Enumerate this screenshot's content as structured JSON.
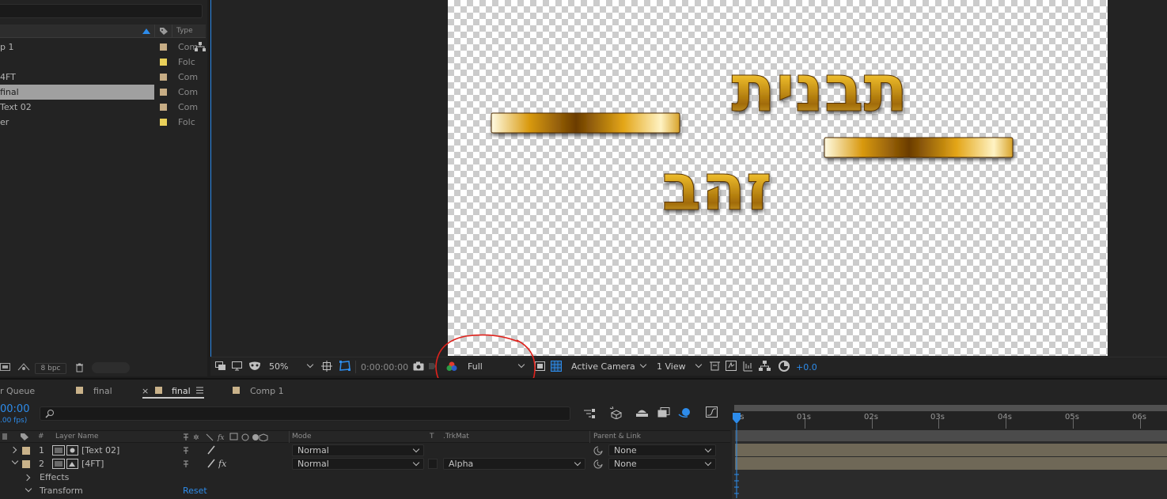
{
  "project": {
    "header": {
      "type_label": "Type"
    },
    "items": [
      {
        "name": "p 1",
        "type": "Com",
        "color": "#c7ad85"
      },
      {
        "name": "",
        "type": "Folc",
        "color": "#e9d05a"
      },
      {
        "name": "4FT",
        "type": "Com",
        "color": "#c7ad85"
      },
      {
        "name": "final",
        "type": "Com",
        "color": "#c7ad85",
        "selected": true
      },
      {
        "name": "Text 02",
        "type": "Com",
        "color": "#c7ad85"
      },
      {
        "name": "er",
        "type": "Folc",
        "color": "#e9d05a"
      }
    ],
    "footer": {
      "bpc": "8 bpc"
    }
  },
  "viewer": {
    "comp_text": {
      "line1": "תבנית",
      "line2": "זהב"
    },
    "zoom": "50%",
    "timecode": "0:00:00:00",
    "resolution": "Full",
    "camera": "Active Camera",
    "views": "1 View",
    "exposure": "+0.0"
  },
  "tabs": [
    {
      "label": "r Queue"
    },
    {
      "label": "final"
    },
    {
      "label": "final",
      "active": true,
      "close": "×"
    },
    {
      "label": "Comp 1"
    }
  ],
  "timeline": {
    "current_time": "00:00",
    "fps": ".00 fps)",
    "columns": {
      "num": "#",
      "layer_name": "Layer Name",
      "mode": "Mode",
      "t": "T",
      "trkmat": ".TrkMat",
      "parent": "Parent & Link"
    },
    "layers": [
      {
        "num": "1",
        "name": "[Text 02]",
        "mode": "Normal",
        "trkmat": "",
        "parent": "None"
      },
      {
        "num": "2",
        "name": "[4FT]",
        "mode": "Normal",
        "trkmat": "Alpha",
        "parent": "None"
      }
    ],
    "properties": {
      "effects": "Effects",
      "transform": "Transform",
      "reset": "Reset"
    },
    "ruler": [
      "0s",
      "01s",
      "02s",
      "03s",
      "04s",
      "05s",
      "06s"
    ]
  },
  "colors": {
    "accent": "#2d8ceb",
    "annotation": "#e0221c",
    "layer_bar": "#6f6857"
  }
}
